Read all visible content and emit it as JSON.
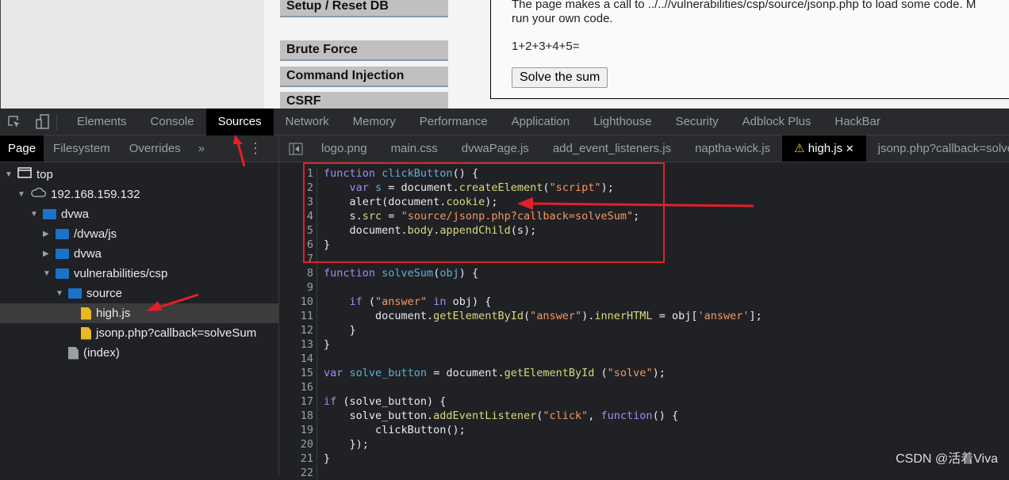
{
  "page": {
    "menu": [
      "Setup / Reset DB",
      "Brute Force",
      "Command Injection",
      "CSRF"
    ],
    "description_line1": "The page makes a call to ../..//vulnerabilities/csp/source/jsonp.php to load some code. M",
    "description_line2": "run your own code.",
    "sum_label": "1+2+3+4+5=",
    "solve_button": "Solve the sum"
  },
  "devtools": {
    "tabs": [
      "Elements",
      "Console",
      "Sources",
      "Network",
      "Memory",
      "Performance",
      "Application",
      "Lighthouse",
      "Security",
      "Adblock Plus",
      "HackBar"
    ],
    "active_tab": "Sources",
    "nav_tabs": [
      "Page",
      "Filesystem",
      "Overrides"
    ],
    "more": "»",
    "file_tabs": [
      "logo.png",
      "main.css",
      "dvwaPage.js",
      "add_event_listeners.js",
      "naptha-wick.js",
      "high.js",
      "jsonp.php?callback=solve"
    ],
    "active_file": "high.js"
  },
  "tree": [
    {
      "label": "top",
      "depth": 0,
      "type": "frame",
      "open": true
    },
    {
      "label": "192.168.159.132",
      "depth": 1,
      "type": "cloud",
      "open": true
    },
    {
      "label": "dvwa",
      "depth": 2,
      "type": "folder",
      "open": true
    },
    {
      "label": "/dvwa/js",
      "depth": 3,
      "type": "folder",
      "open": false
    },
    {
      "label": "dvwa",
      "depth": 3,
      "type": "folder",
      "open": false
    },
    {
      "label": "vulnerabilities/csp",
      "depth": 3,
      "type": "folder",
      "open": true
    },
    {
      "label": "source",
      "depth": 4,
      "type": "folder",
      "open": true
    },
    {
      "label": "high.js",
      "depth": 5,
      "type": "file",
      "selected": true
    },
    {
      "label": "jsonp.php?callback=solveSum",
      "depth": 5,
      "type": "file"
    },
    {
      "label": "(index)",
      "depth": 4,
      "type": "doc"
    }
  ],
  "code": [
    [
      [
        "function ",
        "kw"
      ],
      [
        "clickButton",
        "id"
      ],
      [
        "() {",
        "txt"
      ]
    ],
    [
      [
        "    ",
        "txt"
      ],
      [
        "var ",
        "kw"
      ],
      [
        "s",
        "id"
      ],
      [
        " = document.",
        "txt"
      ],
      [
        "createElement",
        "prop"
      ],
      [
        "(",
        "txt"
      ],
      [
        "\"script\"",
        "str"
      ],
      [
        ");",
        "txt"
      ]
    ],
    [
      [
        "    alert(document.",
        "txt"
      ],
      [
        "cookie",
        "prop"
      ],
      [
        ");",
        "txt"
      ]
    ],
    [
      [
        "    s.",
        "txt"
      ],
      [
        "src",
        "prop"
      ],
      [
        " = ",
        "txt"
      ],
      [
        "\"source/jsonp.php?callback=solveSum\"",
        "str"
      ],
      [
        ";",
        "txt"
      ]
    ],
    [
      [
        "    document.",
        "txt"
      ],
      [
        "body",
        "prop"
      ],
      [
        ".",
        "txt"
      ],
      [
        "appendChild",
        "prop"
      ],
      [
        "(s);",
        "txt"
      ]
    ],
    [
      [
        "}",
        "txt"
      ]
    ],
    [],
    [
      [
        "function ",
        "kw"
      ],
      [
        "solveSum",
        "id"
      ],
      [
        "(",
        "txt"
      ],
      [
        "obj",
        "id"
      ],
      [
        ") {",
        "txt"
      ]
    ],
    [],
    [
      [
        "    ",
        "txt"
      ],
      [
        "if ",
        "kw"
      ],
      [
        "(",
        "txt"
      ],
      [
        "\"answer\"",
        "str"
      ],
      [
        " in ",
        "kw"
      ],
      [
        "obj) {",
        "txt"
      ]
    ],
    [
      [
        "        document.",
        "txt"
      ],
      [
        "getElementById",
        "prop"
      ],
      [
        "(",
        "txt"
      ],
      [
        "\"answer\"",
        "str"
      ],
      [
        ").",
        "txt"
      ],
      [
        "innerHTML",
        "prop"
      ],
      [
        " = obj[",
        "txt"
      ],
      [
        "'answer'",
        "str"
      ],
      [
        "];",
        "txt"
      ]
    ],
    [
      [
        "    }",
        "txt"
      ]
    ],
    [
      [
        "}",
        "txt"
      ]
    ],
    [],
    [
      [
        "var ",
        "kw"
      ],
      [
        "solve_button",
        "id"
      ],
      [
        " = document.",
        "txt"
      ],
      [
        "getElementById",
        "prop"
      ],
      [
        " (",
        "txt"
      ],
      [
        "\"solve\"",
        "str"
      ],
      [
        ");",
        "txt"
      ]
    ],
    [],
    [
      [
        "if ",
        "kw"
      ],
      [
        "(solve_button) {",
        "txt"
      ]
    ],
    [
      [
        "    solve_button.",
        "txt"
      ],
      [
        "addEventListener",
        "prop"
      ],
      [
        "(",
        "txt"
      ],
      [
        "\"click\"",
        "str"
      ],
      [
        ", ",
        "txt"
      ],
      [
        "function",
        "kw"
      ],
      [
        "() {",
        "txt"
      ]
    ],
    [
      [
        "        clickButton();",
        "txt"
      ]
    ],
    [
      [
        "    });",
        "txt"
      ]
    ],
    [
      [
        "}",
        "txt"
      ]
    ],
    []
  ],
  "watermark": "CSDN @活着Viva",
  "colors": {
    "annotation": "#e3202a",
    "folder": "#1a73c8",
    "file": "#e8b923"
  }
}
